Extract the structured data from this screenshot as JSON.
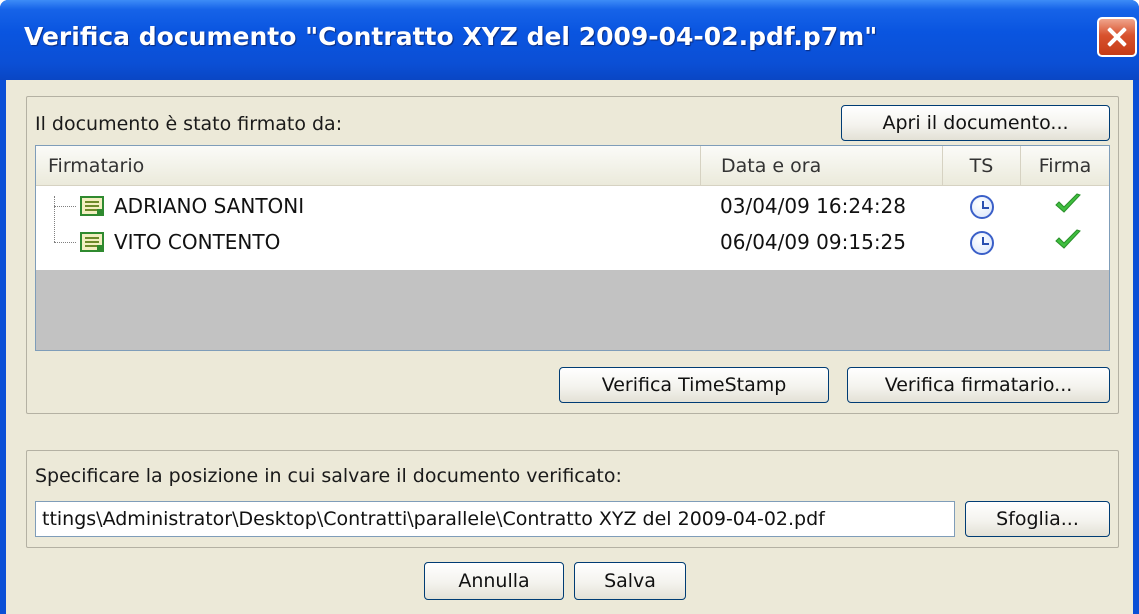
{
  "window": {
    "title": "Verifica documento \"Contratto XYZ del 2009-04-02.pdf.p7m\""
  },
  "signers_group": {
    "label": "Il documento è stato firmato da:",
    "open_button": "Apri il documento...",
    "columns": [
      "Firmatario",
      "Data e ora",
      "TS",
      "Firma"
    ],
    "rows": [
      {
        "name": "ADRIANO SANTONI",
        "datetime": "03/04/09 16:24:28",
        "ts_icon": "clock-icon",
        "firma_icon": "check-icon"
      },
      {
        "name": "VITO CONTENTO",
        "datetime": "06/04/09 09:15:25",
        "ts_icon": "clock-icon",
        "firma_icon": "check-icon"
      }
    ],
    "verify_timestamp_button": "Verifica TimeStamp",
    "verify_signer_button": "Verifica firmatario..."
  },
  "save_group": {
    "label": "Specificare la posizione in cui salvare il documento verificato:",
    "path_value": "ttings\\Administrator\\Desktop\\Contratti\\parallele\\Contratto XYZ del 2009-04-02.pdf",
    "browse_button": "Sfoglia..."
  },
  "footer": {
    "cancel_button": "Annulla",
    "save_button": "Salva"
  },
  "colors": {
    "titlebar": "#0a55e0",
    "dialog_bg": "#ece9d8",
    "check_green": "#3fbf3f",
    "clock_blue": "#3a5fc8"
  }
}
